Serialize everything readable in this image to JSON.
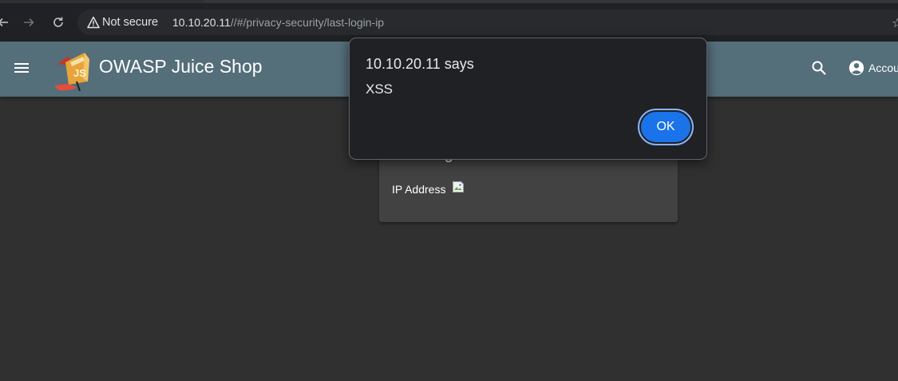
{
  "browser": {
    "security_label": "Not secure",
    "url_host": "10.10.20.11",
    "url_path": "//#/privacy-security/last-login-ip"
  },
  "app": {
    "title": "OWASP Juice Shop",
    "account_label": "Account"
  },
  "card": {
    "title": "Last Login IP",
    "ip_label": "IP Address"
  },
  "alert": {
    "title": "10.10.20.11 says",
    "message": "XSS",
    "ok_label": "OK"
  },
  "colors": {
    "toolbar": "#546e7a",
    "background": "#303030",
    "card": "#424242",
    "dialog": "#202124",
    "ok_button": "#1a73e8"
  }
}
